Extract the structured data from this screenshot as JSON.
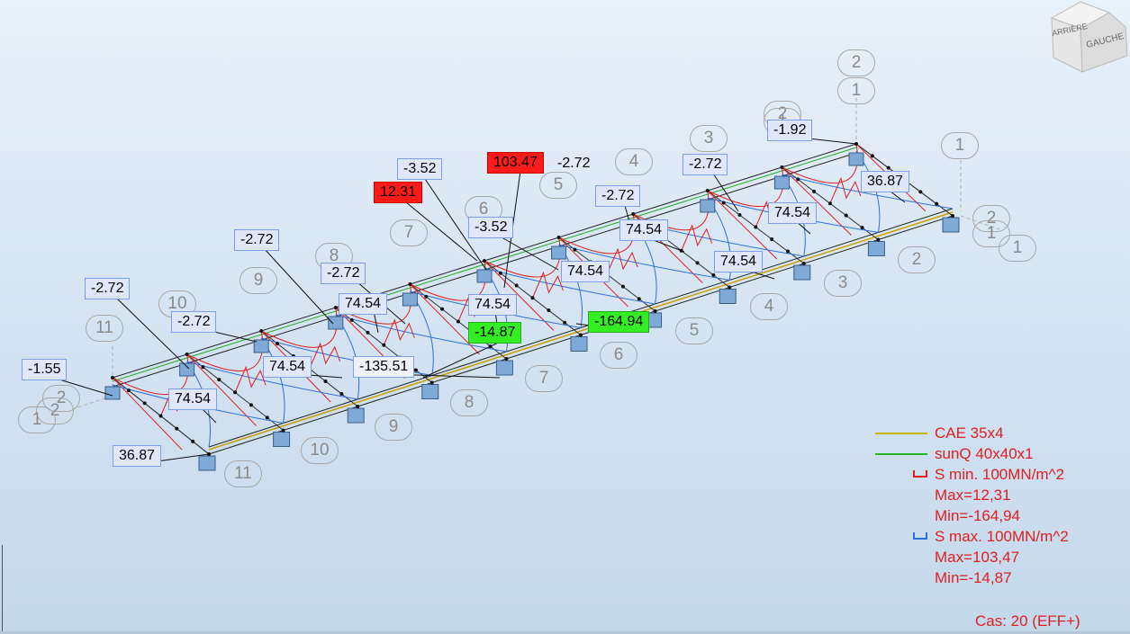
{
  "navcube": {
    "left_label": "ARRIÈRE",
    "right_label": "GAUCHE"
  },
  "stress_labels": [
    {
      "text": "-1.92",
      "style": "normal"
    },
    {
      "text": "36.87",
      "style": "normal"
    },
    {
      "text": "-2.72",
      "style": "normal"
    },
    {
      "text": "74.54",
      "style": "normal"
    },
    {
      "text": "-2.72",
      "style": "normal"
    },
    {
      "text": "74.54",
      "style": "normal"
    },
    {
      "text": "74.54",
      "style": "normal"
    },
    {
      "text": "103.47",
      "style": "red"
    },
    {
      "text": "-2.72",
      "style": "plain"
    },
    {
      "text": "-3.52",
      "style": "normal"
    },
    {
      "text": "12.31",
      "style": "red"
    },
    {
      "text": "-3.52",
      "style": "normal"
    },
    {
      "text": "74.54",
      "style": "normal"
    },
    {
      "text": "-2.72",
      "style": "normal"
    },
    {
      "text": "-2.72",
      "style": "normal"
    },
    {
      "text": "74.54",
      "style": "normal"
    },
    {
      "text": "74.54",
      "style": "normal"
    },
    {
      "text": "-14.87",
      "style": "green"
    },
    {
      "text": "-164.94",
      "style": "green"
    },
    {
      "text": "-2.72",
      "style": "normal"
    },
    {
      "text": "-2.72",
      "style": "normal"
    },
    {
      "text": "74.54",
      "style": "normal"
    },
    {
      "text": "-135.51",
      "style": "white"
    },
    {
      "text": "-1.55",
      "style": "normal"
    },
    {
      "text": "74.54",
      "style": "normal"
    },
    {
      "text": "36.87",
      "style": "normal"
    }
  ],
  "grid_bubbles": [
    "2",
    "1",
    "2",
    "1",
    "3",
    "4",
    "5",
    "6",
    "7",
    "8",
    "9",
    "10",
    "11",
    "2",
    "1",
    "1",
    "2",
    "3",
    "4",
    "5",
    "6",
    "7",
    "8",
    "9",
    "10",
    "11",
    "2",
    "2",
    "1",
    "1"
  ],
  "legend": {
    "items": [
      {
        "text": "CAE 35x4",
        "color": "#c8b400",
        "kind": "line"
      },
      {
        "text": "sunQ 40x40x1",
        "color": "#22b822",
        "kind": "line"
      },
      {
        "text": "S min. 100MN/m^2",
        "color": "#e02020",
        "kind": "bracket"
      },
      {
        "text": "Max=12,31",
        "color": "#e02020",
        "kind": "text"
      },
      {
        "text": "Min=-164,94",
        "color": "#e02020",
        "kind": "text"
      },
      {
        "text": "S max. 100MN/m^2",
        "color": "#2d6fe0",
        "kind": "bracket"
      },
      {
        "text": "Max=103,47",
        "color": "#e02020",
        "kind": "text"
      },
      {
        "text": "Min=-14,87",
        "color": "#e02020",
        "kind": "text"
      }
    ]
  },
  "case_label": "Cas: 20 (EFF+)"
}
